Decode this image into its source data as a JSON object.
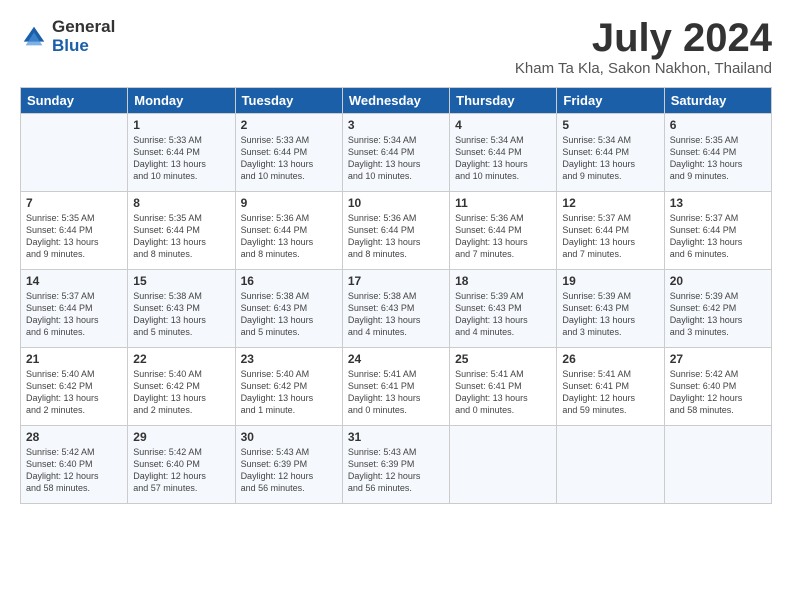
{
  "logo": {
    "general": "General",
    "blue": "Blue"
  },
  "title": "July 2024",
  "subtitle": "Kham Ta Kla, Sakon Nakhon, Thailand",
  "headers": [
    "Sunday",
    "Monday",
    "Tuesday",
    "Wednesday",
    "Thursday",
    "Friday",
    "Saturday"
  ],
  "weeks": [
    [
      {
        "day": "",
        "info": ""
      },
      {
        "day": "1",
        "info": "Sunrise: 5:33 AM\nSunset: 6:44 PM\nDaylight: 13 hours\nand 10 minutes."
      },
      {
        "day": "2",
        "info": "Sunrise: 5:33 AM\nSunset: 6:44 PM\nDaylight: 13 hours\nand 10 minutes."
      },
      {
        "day": "3",
        "info": "Sunrise: 5:34 AM\nSunset: 6:44 PM\nDaylight: 13 hours\nand 10 minutes."
      },
      {
        "day": "4",
        "info": "Sunrise: 5:34 AM\nSunset: 6:44 PM\nDaylight: 13 hours\nand 10 minutes."
      },
      {
        "day": "5",
        "info": "Sunrise: 5:34 AM\nSunset: 6:44 PM\nDaylight: 13 hours\nand 9 minutes."
      },
      {
        "day": "6",
        "info": "Sunrise: 5:35 AM\nSunset: 6:44 PM\nDaylight: 13 hours\nand 9 minutes."
      }
    ],
    [
      {
        "day": "7",
        "info": "Sunrise: 5:35 AM\nSunset: 6:44 PM\nDaylight: 13 hours\nand 9 minutes."
      },
      {
        "day": "8",
        "info": "Sunrise: 5:35 AM\nSunset: 6:44 PM\nDaylight: 13 hours\nand 8 minutes."
      },
      {
        "day": "9",
        "info": "Sunrise: 5:36 AM\nSunset: 6:44 PM\nDaylight: 13 hours\nand 8 minutes."
      },
      {
        "day": "10",
        "info": "Sunrise: 5:36 AM\nSunset: 6:44 PM\nDaylight: 13 hours\nand 8 minutes."
      },
      {
        "day": "11",
        "info": "Sunrise: 5:36 AM\nSunset: 6:44 PM\nDaylight: 13 hours\nand 7 minutes."
      },
      {
        "day": "12",
        "info": "Sunrise: 5:37 AM\nSunset: 6:44 PM\nDaylight: 13 hours\nand 7 minutes."
      },
      {
        "day": "13",
        "info": "Sunrise: 5:37 AM\nSunset: 6:44 PM\nDaylight: 13 hours\nand 6 minutes."
      }
    ],
    [
      {
        "day": "14",
        "info": "Sunrise: 5:37 AM\nSunset: 6:44 PM\nDaylight: 13 hours\nand 6 minutes."
      },
      {
        "day": "15",
        "info": "Sunrise: 5:38 AM\nSunset: 6:43 PM\nDaylight: 13 hours\nand 5 minutes."
      },
      {
        "day": "16",
        "info": "Sunrise: 5:38 AM\nSunset: 6:43 PM\nDaylight: 13 hours\nand 5 minutes."
      },
      {
        "day": "17",
        "info": "Sunrise: 5:38 AM\nSunset: 6:43 PM\nDaylight: 13 hours\nand 4 minutes."
      },
      {
        "day": "18",
        "info": "Sunrise: 5:39 AM\nSunset: 6:43 PM\nDaylight: 13 hours\nand 4 minutes."
      },
      {
        "day": "19",
        "info": "Sunrise: 5:39 AM\nSunset: 6:43 PM\nDaylight: 13 hours\nand 3 minutes."
      },
      {
        "day": "20",
        "info": "Sunrise: 5:39 AM\nSunset: 6:42 PM\nDaylight: 13 hours\nand 3 minutes."
      }
    ],
    [
      {
        "day": "21",
        "info": "Sunrise: 5:40 AM\nSunset: 6:42 PM\nDaylight: 13 hours\nand 2 minutes."
      },
      {
        "day": "22",
        "info": "Sunrise: 5:40 AM\nSunset: 6:42 PM\nDaylight: 13 hours\nand 2 minutes."
      },
      {
        "day": "23",
        "info": "Sunrise: 5:40 AM\nSunset: 6:42 PM\nDaylight: 13 hours\nand 1 minute."
      },
      {
        "day": "24",
        "info": "Sunrise: 5:41 AM\nSunset: 6:41 PM\nDaylight: 13 hours\nand 0 minutes."
      },
      {
        "day": "25",
        "info": "Sunrise: 5:41 AM\nSunset: 6:41 PM\nDaylight: 13 hours\nand 0 minutes."
      },
      {
        "day": "26",
        "info": "Sunrise: 5:41 AM\nSunset: 6:41 PM\nDaylight: 12 hours\nand 59 minutes."
      },
      {
        "day": "27",
        "info": "Sunrise: 5:42 AM\nSunset: 6:40 PM\nDaylight: 12 hours\nand 58 minutes."
      }
    ],
    [
      {
        "day": "28",
        "info": "Sunrise: 5:42 AM\nSunset: 6:40 PM\nDaylight: 12 hours\nand 58 minutes."
      },
      {
        "day": "29",
        "info": "Sunrise: 5:42 AM\nSunset: 6:40 PM\nDaylight: 12 hours\nand 57 minutes."
      },
      {
        "day": "30",
        "info": "Sunrise: 5:43 AM\nSunset: 6:39 PM\nDaylight: 12 hours\nand 56 minutes."
      },
      {
        "day": "31",
        "info": "Sunrise: 5:43 AM\nSunset: 6:39 PM\nDaylight: 12 hours\nand 56 minutes."
      },
      {
        "day": "",
        "info": ""
      },
      {
        "day": "",
        "info": ""
      },
      {
        "day": "",
        "info": ""
      }
    ]
  ]
}
